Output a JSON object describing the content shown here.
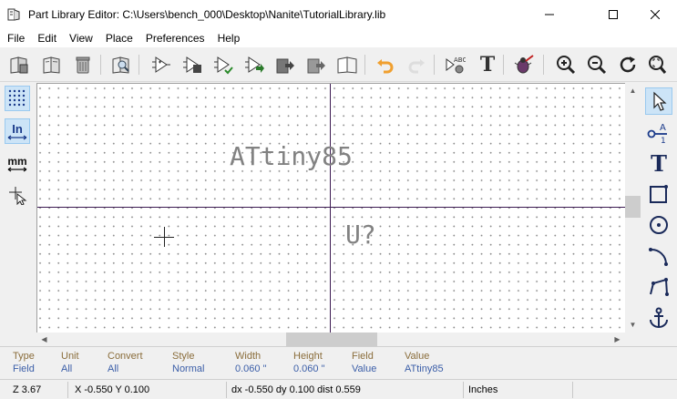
{
  "window": {
    "title": "Part Library Editor: C:\\Users\\bench_000\\Desktop\\Nanite\\TutorialLibrary.lib",
    "minimize_glyph": "—",
    "maximize_glyph": "☐",
    "close_glyph": "✕"
  },
  "menu": [
    "File",
    "Edit",
    "View",
    "Place",
    "Preferences",
    "Help"
  ],
  "toolbar": {
    "icons": [
      "select-library-icon",
      "save-library-icon",
      "delete-part-icon",
      "browse-library-icon",
      "new-component-icon",
      "load-component-icon",
      "save-component-icon",
      "import-component-icon",
      "export-component-icon",
      "create-library-icon",
      "documentation-icon",
      "undo-icon",
      "redo-icon",
      "component-properties-icon",
      "text-edit-icon",
      "erc-check-icon",
      "zoom-in-icon",
      "zoom-out-icon",
      "redraw-icon",
      "zoom-fit-icon"
    ],
    "abc_label": "ABC",
    "text_label": "T"
  },
  "left_toolbar": {
    "in_label": "In",
    "mm_label": "mm"
  },
  "right_toolbar": {
    "pin_label": "A",
    "pin_sub": "1",
    "text_label": "T"
  },
  "canvas": {
    "value_field": "ATtiny85",
    "reference_field": "U?"
  },
  "message_panel": [
    {
      "header": "Type",
      "value": "Field"
    },
    {
      "header": "Unit",
      "value": "All"
    },
    {
      "header": "Convert",
      "value": "All"
    },
    {
      "header": "Style",
      "value": "Normal"
    },
    {
      "header": "Width",
      "value": "0.060 \""
    },
    {
      "header": "Height",
      "value": "0.060 \""
    },
    {
      "header": "Field",
      "value": "Value"
    },
    {
      "header": "Value",
      "value": "ATtiny85"
    }
  ],
  "status": {
    "zoom": "Z 3.67",
    "coords": "X -0.550  Y 0.100",
    "delta": "dx -0.550  dy 0.100  dist 0.559",
    "units": "Inches"
  },
  "colors": {
    "axis": "#3c1a52",
    "field_text": "#828282",
    "msg_header": "#8a6d3b",
    "msg_value": "#3b5ea8",
    "active_tool_bg": "#cce4f7"
  }
}
